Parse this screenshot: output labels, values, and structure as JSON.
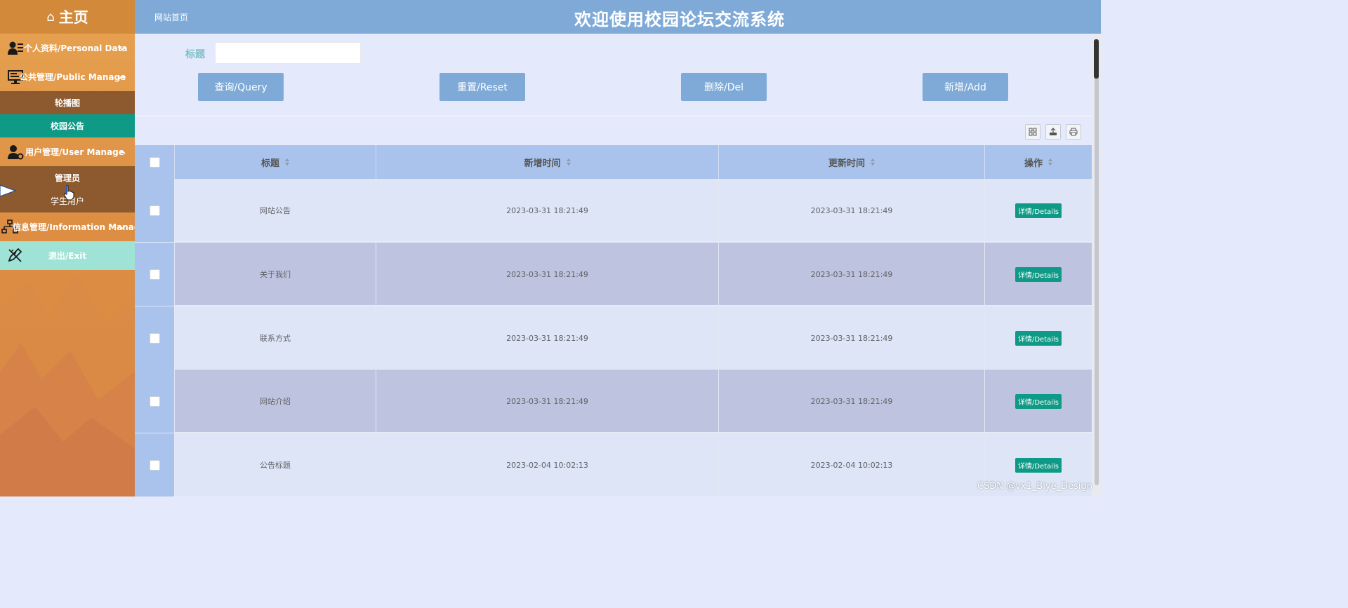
{
  "sidebar": {
    "home_label": "主页",
    "menus": [
      {
        "label": "个人资料/Personal Data",
        "expanded": false
      },
      {
        "label": "公共管理/Public Manage",
        "expanded": true,
        "items": [
          {
            "label": "轮播图",
            "active": false
          },
          {
            "label": "校园公告",
            "active": true
          }
        ]
      },
      {
        "label": "用户管理/User Manage",
        "expanded": true,
        "items": [
          {
            "label": "管理员",
            "active": false
          },
          {
            "label": "学生用户",
            "active": false
          }
        ]
      },
      {
        "label": "信息管理/Information Manage",
        "expanded": false
      }
    ],
    "exit_label": "退出/Exit"
  },
  "header": {
    "breadcrumb": "网站首页",
    "title": "欢迎使用校园论坛交流系统"
  },
  "search": {
    "title_label": "标题",
    "title_value": "",
    "buttons": {
      "query": "查询/Query",
      "reset": "重置/Reset",
      "delete": "删除/Del",
      "add": "新增/Add"
    }
  },
  "toolbar": {
    "icons": [
      "columns-icon",
      "export-icon",
      "print-icon"
    ]
  },
  "table": {
    "columns": [
      "标题",
      "新增时间",
      "更新时间",
      "操作"
    ],
    "rows": [
      {
        "title": "网站公告",
        "created": "2023-03-31 18:21:49",
        "updated": "2023-03-31 18:21:49",
        "action": "详情/Details"
      },
      {
        "title": "关于我们",
        "created": "2023-03-31 18:21:49",
        "updated": "2023-03-31 18:21:49",
        "action": "详情/Details"
      },
      {
        "title": "联系方式",
        "created": "2023-03-31 18:21:49",
        "updated": "2023-03-31 18:21:49",
        "action": "详情/Details"
      },
      {
        "title": "网站介绍",
        "created": "2023-03-31 18:21:49",
        "updated": "2023-03-31 18:21:49",
        "action": "详情/Details"
      },
      {
        "title": "公告标题",
        "created": "2023-02-04 10:02:13",
        "updated": "2023-02-04 10:02:13",
        "action": "详情/Details"
      }
    ]
  },
  "watermark": "CSDN @vx1_Biye_Design",
  "colors": {
    "header": "#7faad7",
    "sidebar": "#e09a4a",
    "active_menu": "#0e9a86",
    "detail_button": "#0e9a86",
    "page_bg": "#e4e9fb"
  }
}
